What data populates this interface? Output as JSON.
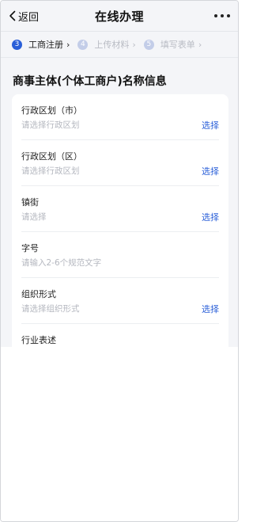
{
  "header": {
    "back_label": "返回",
    "title": "在线办理"
  },
  "steps": [
    {
      "num": "3",
      "label": "工商注册",
      "arrow": "›",
      "state": "active"
    },
    {
      "num": "4",
      "label": "上传材料",
      "arrow": "›",
      "state": "inactive"
    },
    {
      "num": "5",
      "label": "填写表单",
      "arrow": "›",
      "state": "inactive"
    }
  ],
  "section": {
    "title": "商事主体(个体工商户)名称信息"
  },
  "fields": [
    {
      "label": "行政区划（市）",
      "placeholder": "请选择行政区划",
      "action": "选择"
    },
    {
      "label": "行政区划（区）",
      "placeholder": "请选择行政区划",
      "action": "选择"
    },
    {
      "label": "镇街",
      "placeholder": "请选择",
      "action": "选择"
    },
    {
      "label": "字号",
      "placeholder": "请输入2-6个规范文字",
      "action": ""
    },
    {
      "label": "组织形式",
      "placeholder": "请选择组织形式",
      "action": "选择"
    },
    {
      "label": "行业表述",
      "placeholder": "",
      "action": ""
    }
  ],
  "colors": {
    "accent": "#2a5fd8",
    "background": "#f4f5f8",
    "inactive_step": "#c3cde8"
  },
  "icons": {
    "back": "chevron-left-icon",
    "more": "more-dots-icon"
  }
}
